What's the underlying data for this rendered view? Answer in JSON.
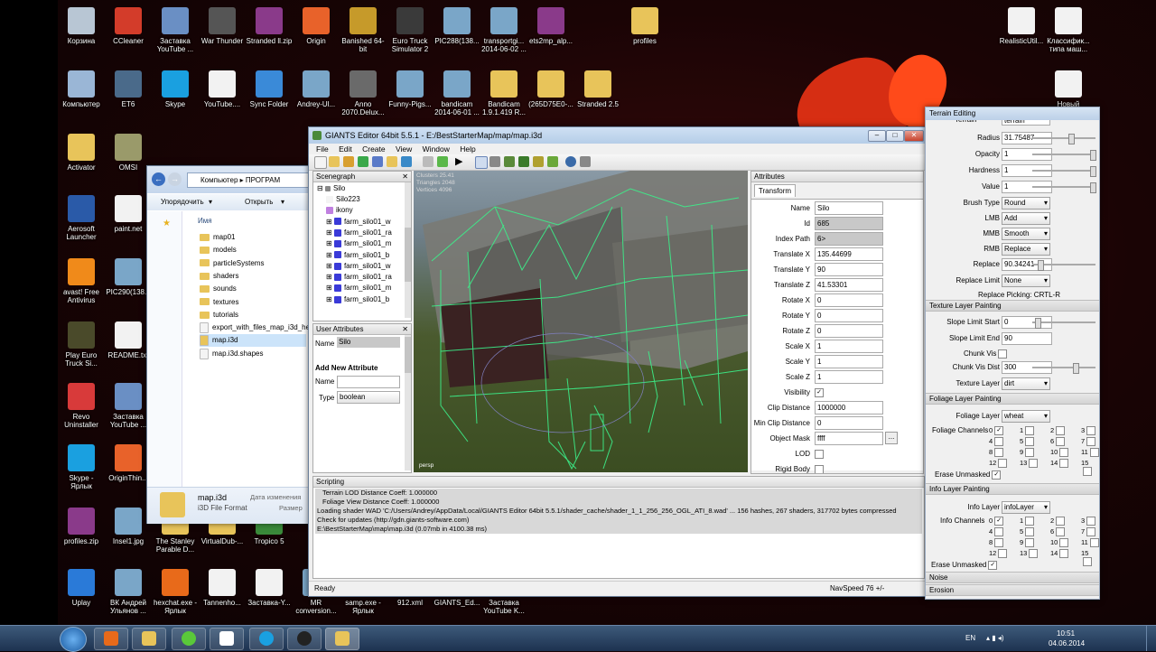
{
  "desktop": {
    "icons": [
      {
        "label": "Корзина",
        "color": "#b8c6d4"
      },
      {
        "label": "CCleaner",
        "color": "#d33c2a"
      },
      {
        "label": "Заставка YouTube ...",
        "color": "#6a8fc4"
      },
      {
        "label": "War Thunder",
        "color": "#555555"
      },
      {
        "label": "Stranded ll.zip",
        "color": "#8a3a8a"
      },
      {
        "label": "Origin",
        "color": "#e8622a"
      },
      {
        "label": "Banished 64-bit",
        "color": "#c69a2a"
      },
      {
        "label": "Euro Truck Simulator 2",
        "color": "#3a3a3a"
      },
      {
        "label": "PIC288(138...",
        "color": "#7aa6c8"
      },
      {
        "label": "transportgi... 2014-06-02 ...",
        "color": "#7aa6c8"
      },
      {
        "label": "ets2mp_alp...",
        "color": "#8a3a8a"
      },
      {
        "label": "profiles",
        "color": "#e8c45a"
      },
      {
        "label": "RealisticUtil...",
        "color": "#f2f2f2"
      },
      {
        "label": "Классифик... типа маш...",
        "color": "#f2f2f2"
      },
      {
        "label": "Компьютер",
        "color": "#9ab6d6"
      },
      {
        "label": "ET6",
        "color": "#4a6a8a"
      },
      {
        "label": "Skype",
        "color": "#1aa0e0"
      },
      {
        "label": "YouTube....",
        "color": "#f2f2f2"
      },
      {
        "label": "Sync Folder",
        "color": "#3a8ad8"
      },
      {
        "label": "Andrey-Ul...",
        "color": "#7aa6c8"
      },
      {
        "label": "Anno 2070.Delux...",
        "color": "#6a6a6a"
      },
      {
        "label": "Funny-Pigs...",
        "color": "#7aa6c8"
      },
      {
        "label": "bandicam 2014-06-01 ...",
        "color": "#7aa6c8"
      },
      {
        "label": "Bandicam 1.9.1.419 R...",
        "color": "#e8c45a"
      },
      {
        "label": "(265D75E0-...",
        "color": "#e8c45a"
      },
      {
        "label": "Stranded 2.5",
        "color": "#e8c45a"
      },
      {
        "label": "Новый",
        "color": "#f2f2f2"
      },
      {
        "label": "Activator",
        "color": "#e8c45a"
      },
      {
        "label": "OMSI",
        "color": "#9a9a6a"
      },
      {
        "label": "Aerosoft Launcher",
        "color": "#2a5aa8"
      },
      {
        "label": "paint.net",
        "color": "#f2f2f2"
      },
      {
        "label": "avast! Free Antivirus",
        "color": "#f08a1a"
      },
      {
        "label": "PIC290(138...",
        "color": "#7aa6c8"
      },
      {
        "label": "Play Euro Truck Si...",
        "color": "#4a4a2a"
      },
      {
        "label": "README.txt",
        "color": "#f2f2f2"
      },
      {
        "label": "Revo Uninstaller",
        "color": "#d83a3a"
      },
      {
        "label": "Заставка YouTube ...",
        "color": "#6a8fc4"
      },
      {
        "label": "Skype - Ярлык",
        "color": "#1aa0e0"
      },
      {
        "label": "OriginThin...",
        "color": "#e8622a"
      },
      {
        "label": "profiles.zip",
        "color": "#8a3a8a"
      },
      {
        "label": "Insel1.jpg",
        "color": "#7aa6c8"
      },
      {
        "label": "The Stanley Parable D...",
        "color": "#e8c45a"
      },
      {
        "label": "VirtualDub-...",
        "color": "#e8c45a"
      },
      {
        "label": "Tropico 5",
        "color": "#3a8a3a"
      },
      {
        "label": "Uplay",
        "color": "#2a7ad8"
      },
      {
        "label": "ВК Андрей Ульянов ...",
        "color": "#7aa6c8"
      },
      {
        "label": "hexchat.exe - Ярлык",
        "color": "#e86a1a"
      },
      {
        "label": "Tannenho...",
        "color": "#f2f2f2"
      },
      {
        "label": "Заставка-Y...",
        "color": "#f2f2f2"
      },
      {
        "label": "MR conversion...",
        "color": "#7aa6c8"
      },
      {
        "label": "samp.exe - Ярлык",
        "color": "#f2f2f2"
      },
      {
        "label": "912.xml",
        "color": "#f2f2f2"
      },
      {
        "label": "GIANTS_Ed...",
        "color": "#f2f2f2"
      },
      {
        "label": "Заставка YouTube K...",
        "color": "#f2f2f2"
      }
    ]
  },
  "explorer": {
    "path_root": "Компьютер",
    "path_next": "ПРОГРАМ",
    "organize": "Упорядочить",
    "open": "Открыть",
    "column_name": "Имя",
    "items": [
      "map01",
      "models",
      "particleSystems",
      "shaders",
      "sounds",
      "textures",
      "tutorials",
      "export_with_files_map_i3d_he",
      "map.i3d",
      "map.i3d.shapes"
    ],
    "details_name": "map.i3d",
    "details_type": "i3D File Format",
    "details_date": "Дата изменения",
    "details_size": "Размер"
  },
  "giants": {
    "title": "GIANTS Editor 64bit 5.5.1 - E:/BestStarterMap/map/map.i3d",
    "menu": [
      "File",
      "Edit",
      "Create",
      "View",
      "Window",
      "Help"
    ],
    "scenegraph": {
      "header": "Scenegraph",
      "root": "Silo",
      "children": [
        "Silo223",
        "ikony",
        "farm_silo01_w",
        "farm_silo01_ra",
        "farm_silo01_m",
        "farm_silo01_b",
        "farm_silo01_w",
        "farm_silo01_ra",
        "farm_silo01_m",
        "farm_silo01_b"
      ]
    },
    "viewport": {
      "stats": [
        "Clusters 25.41",
        "Triangles 2048",
        "Vertices 4096"
      ],
      "camera": "persp"
    },
    "user_attributes": {
      "header": "User Attributes",
      "name_label": "Name",
      "name_value": "Silo",
      "add_new": "Add New Attribute",
      "new_name_label": "Name",
      "type_label": "Type",
      "type_value": "boolean"
    },
    "attributes": {
      "header": "Attributes",
      "tab": "Transform",
      "rows": [
        {
          "label": "Name",
          "value": "Silo"
        },
        {
          "label": "Id",
          "value": "685"
        },
        {
          "label": "Index Path",
          "value": "6>"
        },
        {
          "label": "Translate X",
          "value": "135.44699"
        },
        {
          "label": "Translate Y",
          "value": "90"
        },
        {
          "label": "Translate Z",
          "value": "41.53301"
        },
        {
          "label": "Rotate X",
          "value": "0"
        },
        {
          "label": "Rotate Y",
          "value": "0"
        },
        {
          "label": "Rotate Z",
          "value": "0"
        },
        {
          "label": "Scale X",
          "value": "1"
        },
        {
          "label": "Scale Y",
          "value": "1"
        },
        {
          "label": "Scale Z",
          "value": "1"
        },
        {
          "label": "Visibility",
          "value": ""
        },
        {
          "label": "Clip Distance",
          "value": "1000000"
        },
        {
          "label": "Min Clip Distance",
          "value": "0"
        },
        {
          "label": "Object Mask",
          "value": "ffff"
        },
        {
          "label": "LOD",
          "value": ""
        },
        {
          "label": "Rigid Body",
          "value": ""
        },
        {
          "label": "Joint",
          "value": ""
        }
      ],
      "ellipsis": "..."
    },
    "scripting": {
      "header": "Scripting",
      "lines": [
        "Terrain LOD Distance Coeff: 1.000000",
        "Foliage View Distance Coeff: 1.000000",
        "Loading shader WAD 'C:/Users/Andrey/AppData/Local/GIANTS Editor 64bit 5.5.1/shader_cache/shader_1_1_256_256_OGL_ATI_8.wad' ... 156 hashes, 267 shaders, 317702 bytes compressed",
        "Check for updates (http://gdn.giants-software.com)",
        "E:\\BestStarterMap\\map\\map.i3d (0.07mb in 4100.38 ms)"
      ]
    },
    "status": {
      "left": "Ready",
      "right": "NavSpeed 76 +/-"
    }
  },
  "terrain": {
    "title": "Terrain Editing",
    "cutoff_label": "Terrain",
    "cutoff_value": "terrain",
    "rows": [
      {
        "label": "Radius",
        "value": "31.75487",
        "slider": 0.62
      },
      {
        "label": "Opacity",
        "value": "1",
        "slider": 1.0
      },
      {
        "label": "Hardness",
        "value": "1",
        "slider": 1.0
      },
      {
        "label": "Value",
        "value": "1",
        "slider": 1.0
      }
    ],
    "brush_type": {
      "label": "Brush Type",
      "value": "Round"
    },
    "lmb": {
      "label": "LMB",
      "value": "Add"
    },
    "mmb": {
      "label": "MMB",
      "value": "Smooth"
    },
    "rmb": {
      "label": "RMB",
      "value": "Replace"
    },
    "replace": {
      "label": "Replace",
      "value": "90.34241",
      "slider": 0.1
    },
    "replace_limit": {
      "label": "Replace Limit",
      "value": "None"
    },
    "replace_picking": "Replace Picking: CRTL-R",
    "texture_section": "Texture Layer Painting",
    "slope_start": {
      "label": "Slope Limit Start",
      "value": "0",
      "slider": 0.05
    },
    "slope_end": {
      "label": "Slope Limit End",
      "value": "90"
    },
    "chunk_vis": "Chunk Vis",
    "chunk_vis_dist": {
      "label": "Chunk Vis Dist",
      "value": "300",
      "slider": 0.7
    },
    "texture_layer": {
      "label": "Texture Layer",
      "value": "dirt"
    },
    "foliage_section": "Foliage Layer Painting",
    "foliage_layer": {
      "label": "Foliage Layer",
      "value": "wheat"
    },
    "foliage_channels": "Foliage Channels",
    "channels": [
      "0",
      "1",
      "2",
      "3",
      "4",
      "5",
      "6",
      "7",
      "8",
      "9",
      "10",
      "11",
      "12",
      "13",
      "14",
      "15"
    ],
    "erase_unmasked": "Erase Unmasked",
    "info_section": "Info Layer Painting",
    "info_layer": {
      "label": "Info Layer",
      "value": "infoLayer"
    },
    "info_channels": "Info Channels",
    "erase_unmasked2": "Erase Unmasked",
    "noise": "Noise",
    "erosion": "Erosion"
  },
  "taskbar": {
    "lang": "EN",
    "time": "10:51",
    "date": "04.06.2014"
  }
}
